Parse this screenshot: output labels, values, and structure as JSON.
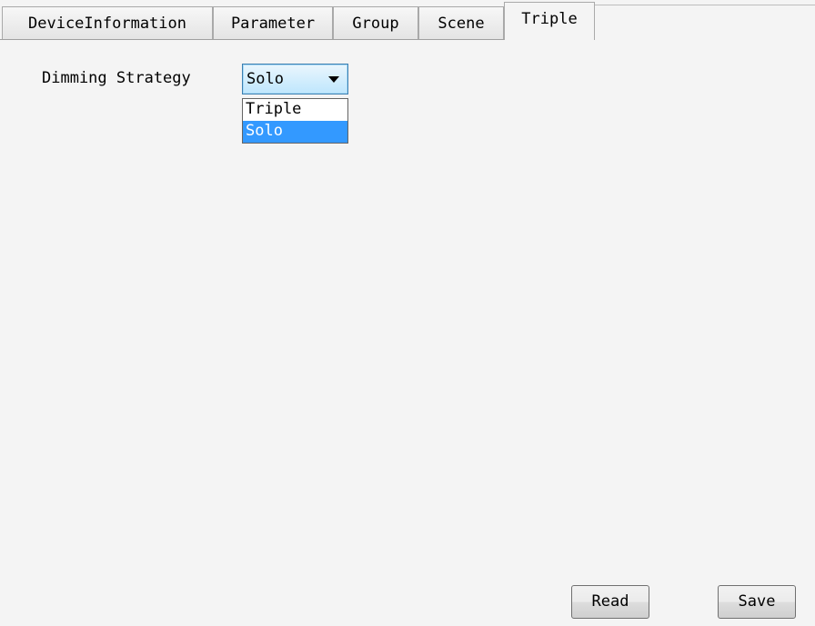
{
  "tabs": [
    {
      "label": "DeviceInformation",
      "active": false
    },
    {
      "label": "Parameter",
      "active": false
    },
    {
      "label": "Group",
      "active": false
    },
    {
      "label": "Scene",
      "active": false
    },
    {
      "label": "Triple",
      "active": true
    }
  ],
  "form": {
    "dimming_strategy_label": "Dimming Strategy",
    "dimming_strategy_value": "Solo",
    "dimming_strategy_options": [
      "Triple",
      "Solo"
    ],
    "highlighted_option": "Solo"
  },
  "buttons": {
    "read_label": "Read",
    "save_label": "Save"
  },
  "colors": {
    "background": "#f4f4f4",
    "selection": "#3399ff",
    "combo_border": "#3c7fb1"
  },
  "icons": {
    "combo_arrow": "chevron-down-icon"
  }
}
